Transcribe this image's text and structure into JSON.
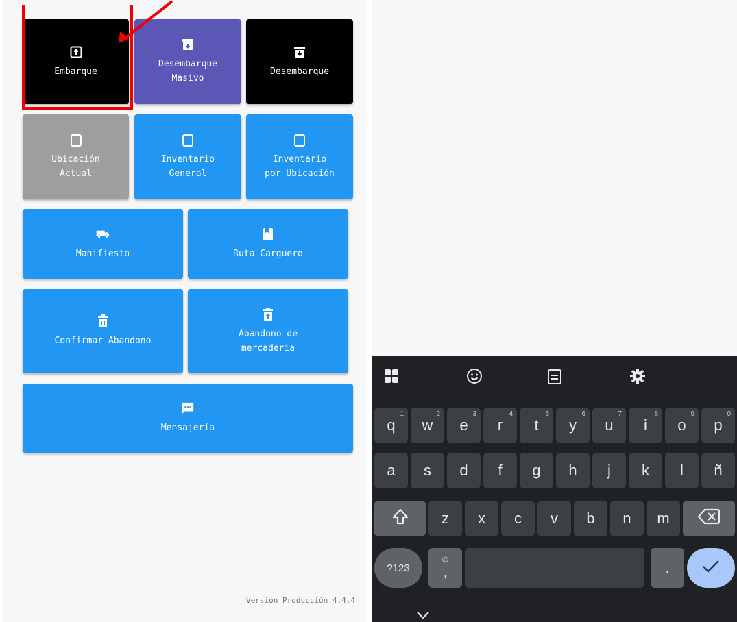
{
  "menu": {
    "row1": [
      {
        "label": "Embarque",
        "icon": "unarchive-icon",
        "color": "#000000"
      },
      {
        "label": "Desembarque\nMasivo",
        "icon": "archive-icon",
        "color": "#5a57b6"
      },
      {
        "label": "Desembarque",
        "icon": "archive-icon",
        "color": "#000000"
      }
    ],
    "row2": [
      {
        "label": "Ubicación\nActual",
        "icon": "clipboard-icon",
        "color": "#9e9e9e"
      },
      {
        "label": "Inventario\nGeneral",
        "icon": "clipboard-icon",
        "color": "#2196f3"
      },
      {
        "label": "Inventario\npor Ubicación",
        "icon": "clipboard-icon",
        "color": "#2196f3"
      }
    ],
    "row3": [
      {
        "label": "Manifiesto",
        "icon": "truck-icon",
        "color": "#2196f3"
      },
      {
        "label": "Ruta Carguero",
        "icon": "book-icon",
        "color": "#2196f3"
      }
    ],
    "row4": [
      {
        "label": "Confirmar Abandono",
        "icon": "delete-icon",
        "color": "#2196f3"
      },
      {
        "label": "Abandono de\nmercaderia",
        "icon": "restore-from-trash-icon",
        "color": "#2196f3"
      }
    ],
    "row5": [
      {
        "label": "Mensajería",
        "icon": "chat-icon",
        "color": "#2196f3"
      }
    ]
  },
  "version": "Versión Producción 4.4.4",
  "keyboard": {
    "toolbar": [
      "apps-grid-icon",
      "emoji-icon",
      "clipboard-icon",
      "settings-gear-icon"
    ],
    "row1": [
      "q",
      "w",
      "e",
      "r",
      "t",
      "y",
      "u",
      "i",
      "o",
      "p"
    ],
    "row1_hints": [
      "1",
      "2",
      "3",
      "4",
      "5",
      "6",
      "7",
      "8",
      "9",
      "0"
    ],
    "row2": [
      "a",
      "s",
      "d",
      "f",
      "g",
      "h",
      "j",
      "k",
      "l",
      "ñ"
    ],
    "row3": [
      "z",
      "x",
      "c",
      "v",
      "b",
      "n",
      "m"
    ],
    "symbols_label": "?123",
    "comma": ",",
    "period": ".",
    "accent_color": "#a8c7fa"
  }
}
